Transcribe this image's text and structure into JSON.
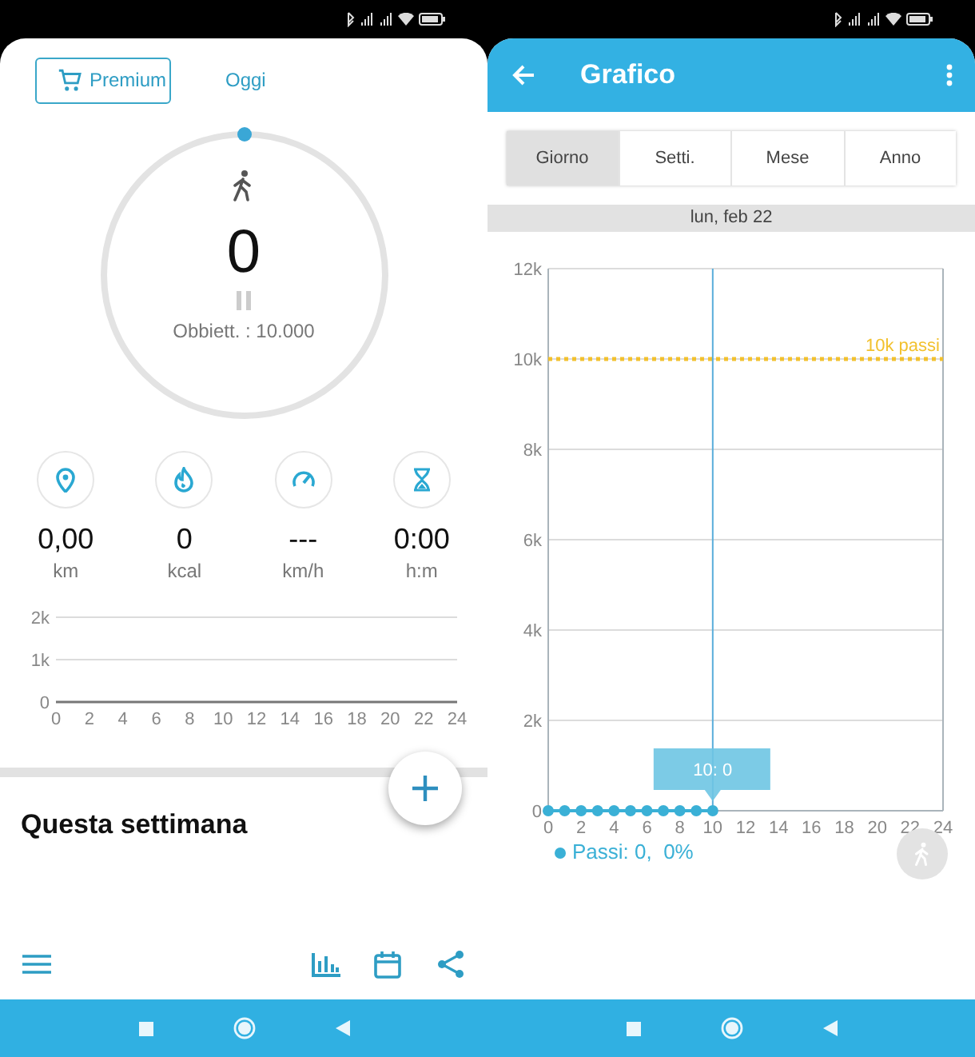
{
  "today_screen": {
    "premium_button": "Premium",
    "tab": "Oggi",
    "steps": "0",
    "goal": "Obbiett. : 10.000",
    "stats": [
      {
        "kind": "distance",
        "value": "0,00",
        "unit": "km"
      },
      {
        "kind": "calories",
        "value": "0",
        "unit": "kcal"
      },
      {
        "kind": "speed",
        "value": "---",
        "unit": "km/h"
      },
      {
        "kind": "time",
        "value": "0:00",
        "unit": "h:m"
      }
    ],
    "chart_data": {
      "type": "line",
      "xlim": [
        0,
        24
      ],
      "ylim": [
        0,
        2000
      ],
      "xticks": [
        0,
        2,
        4,
        6,
        8,
        10,
        12,
        14,
        16,
        18,
        20,
        22,
        24
      ],
      "yticks": [
        {
          "value": 0,
          "label": "0"
        },
        {
          "value": 1000,
          "label": "1k"
        },
        {
          "value": 2000,
          "label": "2k"
        }
      ]
    },
    "section_title": "Questa settimana"
  },
  "chart_screen": {
    "title": "Grafico",
    "tabs": [
      {
        "label": "Giorno",
        "selected": true
      },
      {
        "label": "Setti.",
        "selected": false
      },
      {
        "label": "Mese",
        "selected": false
      },
      {
        "label": "Anno",
        "selected": false
      }
    ],
    "date": "lun, feb 22",
    "chart_data": {
      "type": "line",
      "x": [
        0,
        1,
        2,
        3,
        4,
        5,
        6,
        7,
        8,
        9,
        10
      ],
      "series": [
        {
          "name": "Passi",
          "color": "#3ab0d6",
          "marker": "o",
          "values": [
            0,
            0,
            0,
            0,
            0,
            0,
            0,
            0,
            0,
            0,
            0
          ]
        }
      ],
      "grid": true,
      "xlim": [
        0,
        24
      ],
      "ylim": [
        0,
        12000
      ],
      "xticks": [
        0,
        2,
        4,
        6,
        8,
        10,
        12,
        14,
        16,
        18,
        20,
        22,
        24
      ],
      "yticks": [
        {
          "value": 0,
          "label": "0"
        },
        {
          "value": 2000,
          "label": "2k"
        },
        {
          "value": 4000,
          "label": "4k"
        },
        {
          "value": 6000,
          "label": "6k"
        },
        {
          "value": 8000,
          "label": "8k"
        },
        {
          "value": 10000,
          "label": "10k"
        },
        {
          "value": 12000,
          "label": "12k"
        }
      ],
      "ref_lines": [
        {
          "axis": "y",
          "value": 10000,
          "label": "10k passi",
          "color": "#f2c12e"
        },
        {
          "axis": "x",
          "value": 10,
          "color": "#5aaedb"
        }
      ],
      "annotations": [
        {
          "x": 10,
          "y": 0,
          "text": "10: 0"
        }
      ]
    },
    "legend_value": ": 0,  0%"
  }
}
